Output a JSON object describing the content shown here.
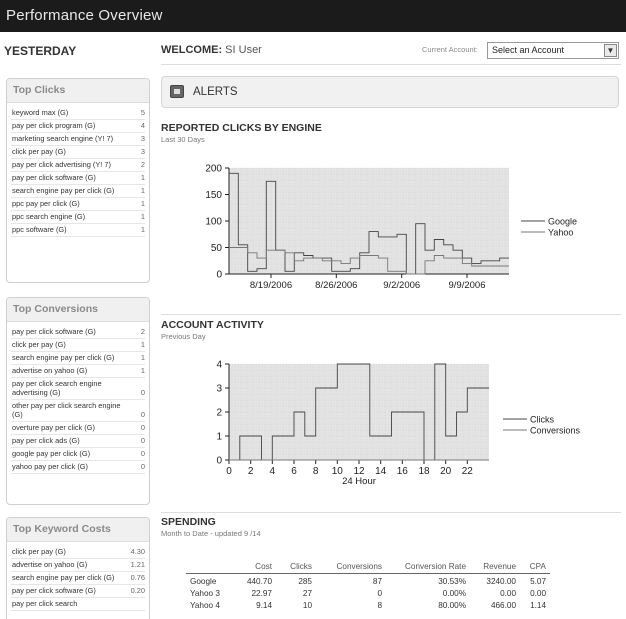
{
  "app": {
    "title": "Performance Overview"
  },
  "yesterday": "YESTERDAY",
  "welcome": {
    "prefix": "WELCOME:",
    "user": "SI User"
  },
  "account": {
    "label": "Current Account:",
    "selected": "Select an Account"
  },
  "alerts": {
    "label": "ALERTS"
  },
  "top_clicks": {
    "title": "Top Clicks",
    "items": [
      {
        "label": "keyword max (G)",
        "value": "5"
      },
      {
        "label": "pay per click program (G)",
        "value": "4"
      },
      {
        "label": "marketing search engine (Y! 7)",
        "value": "3"
      },
      {
        "label": "click per pay (G)",
        "value": "3"
      },
      {
        "label": "pay per click advertising (Y! 7)",
        "value": "2"
      },
      {
        "label": "pay per click software (G)",
        "value": "1"
      },
      {
        "label": "search engine pay per click (G)",
        "value": "1"
      },
      {
        "label": "ppc pay per click (G)",
        "value": "1"
      },
      {
        "label": "ppc search engine (G)",
        "value": "1"
      },
      {
        "label": "ppc software (G)",
        "value": "1"
      }
    ]
  },
  "top_conversions": {
    "title": "Top Conversions",
    "items": [
      {
        "label": "pay per click software (G)",
        "value": "2"
      },
      {
        "label": "click per pay (G)",
        "value": "1"
      },
      {
        "label": "search engine pay per click (G)",
        "value": "1"
      },
      {
        "label": "advertise on yahoo (G)",
        "value": "1"
      },
      {
        "label": "pay per click search engine advertising (G)",
        "value": "0"
      },
      {
        "label": "other pay per click search engine (G)",
        "value": "0"
      },
      {
        "label": "overture pay per click (G)",
        "value": "0"
      },
      {
        "label": "pay per click ads (G)",
        "value": "0"
      },
      {
        "label": "google pay per click (G)",
        "value": "0"
      },
      {
        "label": "yahoo pay per click (G)",
        "value": "0"
      }
    ]
  },
  "top_keyword_costs": {
    "title": "Top Keyword Costs",
    "items": [
      {
        "label": "click per pay (G)",
        "value": "4.30"
      },
      {
        "label": "advertise on yahoo (G)",
        "value": "1.21"
      },
      {
        "label": "search engine pay per click (G)",
        "value": "0.76"
      },
      {
        "label": "pay per click software (G)",
        "value": "0.20"
      },
      {
        "label": "pay per click search",
        "value": ""
      }
    ]
  },
  "reported_clicks": {
    "title": "REPORTED CLICKS BY ENGINE",
    "subtitle": "Last 30 Days"
  },
  "account_activity": {
    "title": "ACCOUNT ACTIVITY",
    "subtitle": "Previous Day"
  },
  "spending": {
    "title": "SPENDING",
    "subtitle": "Month to Date - updated 9 /14",
    "columns": [
      "",
      "Cost",
      "Clicks",
      "Conversions",
      "Conversion Rate",
      "Revenue",
      "CPA"
    ],
    "rows": [
      [
        "Google",
        "440.70",
        "285",
        "87",
        "30.53%",
        "3240.00",
        "5.07"
      ],
      [
        "Yahoo 3",
        "22.97",
        "27",
        "0",
        "0.00%",
        "0.00",
        "0.00"
      ],
      [
        "Yahoo 4",
        "9.14",
        "10",
        "8",
        "80.00%",
        "466.00",
        "1.14"
      ]
    ]
  },
  "chart_data": [
    {
      "type": "line",
      "title": "REPORTED CLICKS BY ENGINE",
      "subtitle": "Last 30 Days",
      "step": true,
      "x_tick_labels": [
        "8/19/2006",
        "8/26/2006",
        "9/2/2006",
        "9/9/2006"
      ],
      "y_ticks": [
        0,
        50,
        100,
        150,
        200
      ],
      "ylim": [
        0,
        200
      ],
      "grid": true,
      "legend": "right",
      "x": [
        "8/15/2006",
        "8/16/2006",
        "8/17/2006",
        "8/18/2006",
        "8/19/2006",
        "8/20/2006",
        "8/21/2006",
        "8/22/2006",
        "8/23/2006",
        "8/24/2006",
        "8/25/2006",
        "8/26/2006",
        "8/27/2006",
        "8/28/2006",
        "8/29/2006",
        "8/30/2006",
        "8/31/2006",
        "9/1/2006",
        "9/2/2006",
        "9/3/2006",
        "9/4/2006",
        "9/5/2006",
        "9/6/2006",
        "9/7/2006",
        "9/8/2006",
        "9/9/2006",
        "9/10/2006",
        "9/11/2006",
        "9/12/2006",
        "9/13/2006"
      ],
      "series": [
        {
          "name": "Google",
          "values": [
            190,
            55,
            5,
            10,
            175,
            45,
            5,
            40,
            35,
            30,
            30,
            5,
            5,
            10,
            40,
            80,
            70,
            70,
            75,
            0,
            95,
            45,
            65,
            55,
            45,
            30,
            20,
            25,
            25,
            30
          ]
        },
        {
          "name": "Yahoo",
          "values": [
            50,
            50,
            40,
            30,
            45,
            45,
            40,
            25,
            30,
            30,
            25,
            25,
            20,
            30,
            35,
            35,
            30,
            5,
            5,
            0,
            0,
            25,
            35,
            30,
            30,
            20,
            15,
            15,
            15,
            15
          ]
        }
      ]
    },
    {
      "type": "line",
      "title": "ACCOUNT ACTIVITY",
      "subtitle": "Previous Day",
      "step": true,
      "xlabel": "24 Hour",
      "x_ticks": [
        0,
        2,
        4,
        6,
        8,
        10,
        12,
        14,
        16,
        18,
        20,
        22
      ],
      "xlim": [
        0,
        23
      ],
      "y_ticks": [
        0,
        1,
        2,
        3,
        4
      ],
      "ylim": [
        0,
        4
      ],
      "grid": true,
      "legend": "right",
      "x": [
        0,
        1,
        2,
        3,
        4,
        5,
        6,
        7,
        8,
        9,
        10,
        11,
        12,
        13,
        14,
        15,
        16,
        17,
        18,
        19,
        20,
        21,
        22,
        23
      ],
      "series": [
        {
          "name": "Clicks",
          "values": [
            0,
            1,
            1,
            0,
            1,
            1,
            2,
            1,
            3,
            3,
            4,
            4,
            4,
            1,
            1,
            2,
            2,
            2,
            0,
            4,
            1,
            2,
            3,
            3
          ]
        },
        {
          "name": "Conversions",
          "values": [
            0,
            0,
            0,
            0,
            0,
            0,
            0,
            0,
            0,
            0,
            0,
            0,
            0,
            0,
            0,
            0,
            0,
            0,
            0,
            0,
            0,
            0,
            0,
            0
          ]
        }
      ]
    }
  ]
}
